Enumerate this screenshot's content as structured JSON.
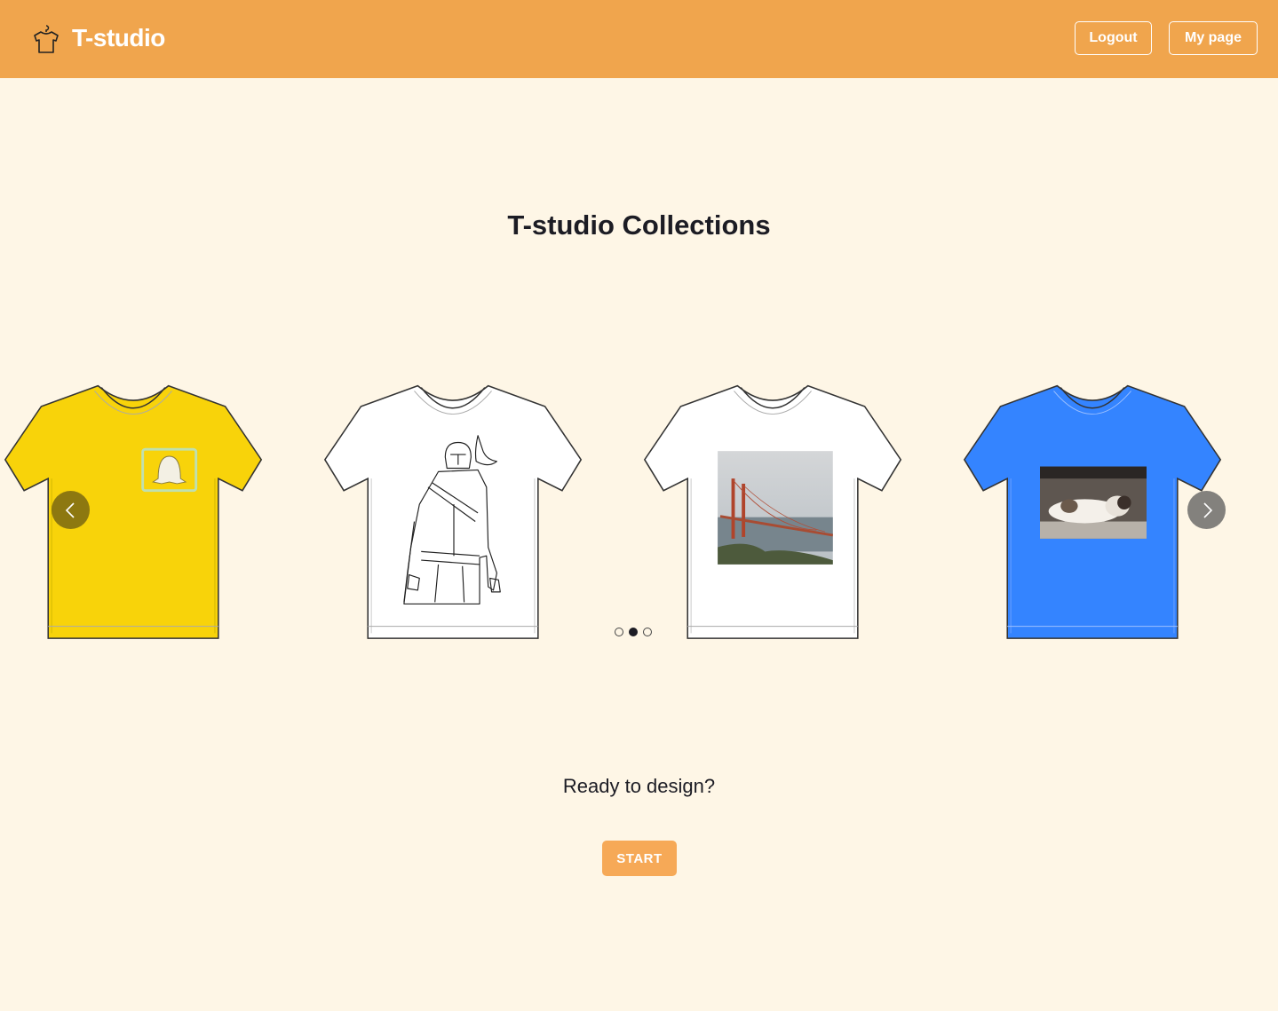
{
  "header": {
    "logo_text": "T-studio",
    "logo_icon": "tshirt-hanger-icon",
    "logout_label": "Logout",
    "mypage_label": "My page",
    "bg_color": "#f0a54d"
  },
  "main": {
    "title": "T-studio Collections",
    "ready_text": "Ready to design?",
    "start_label": "START"
  },
  "carousel": {
    "slides": [
      {
        "shirt_color": "#f8d30a",
        "print": "ghost-logo"
      },
      {
        "shirt_color": "#ffffff",
        "print": "armored-figure-line-art"
      },
      {
        "shirt_color": "#ffffff",
        "print": "bridge-photo"
      },
      {
        "shirt_color": "#3484ff",
        "print": "cat-photo"
      }
    ],
    "prev_icon": "chevron-left-icon",
    "next_icon": "chevron-right-icon",
    "dots": 3,
    "active_dot": 2
  },
  "colors": {
    "page_bg": "#fef6e6",
    "accent": "#f6a957",
    "text": "#1c1c24"
  }
}
